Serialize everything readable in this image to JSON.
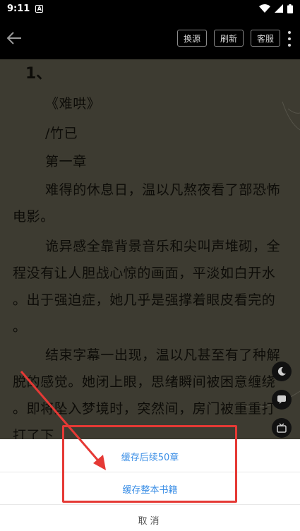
{
  "status_bar": {
    "time": "9:11",
    "badge": "A"
  },
  "toolbar": {
    "buttons": [
      "换源",
      "刷新",
      "客服"
    ]
  },
  "reader": {
    "chapter_no": "1、",
    "lines": [
      "《难哄》",
      "/竹已",
      "第一章",
      "难得的休息日，温以凡熬夜看了部恐怖",
      "电影。",
      "诡异感全靠背景音乐和尖叫声堆砌，全",
      "程没有让人胆战心惊的画面，平淡如白开水",
      "。出于强迫症，她几乎是强撑着眼皮看完的",
      "。",
      "结束字幕一出现，温以凡甚至有了种解",
      "脱的感觉。她闭上眼，思绪瞬间被困意缠绕",
      "。即将坠入梦境时，突然间，房门被重重打",
      "打了下"
    ]
  },
  "sheet": {
    "item1": "缓存后续50章",
    "item2": "缓存整本书籍",
    "cancel": "取消"
  },
  "colors": {
    "accent": "#3a8ee6",
    "highlight": "#e53935"
  },
  "icons": [
    "back-arrow-icon",
    "more-vertical-icon",
    "moon-icon",
    "chat-icon",
    "tv-icon",
    "wifi-icon",
    "signal-icon",
    "battery-icon"
  ]
}
